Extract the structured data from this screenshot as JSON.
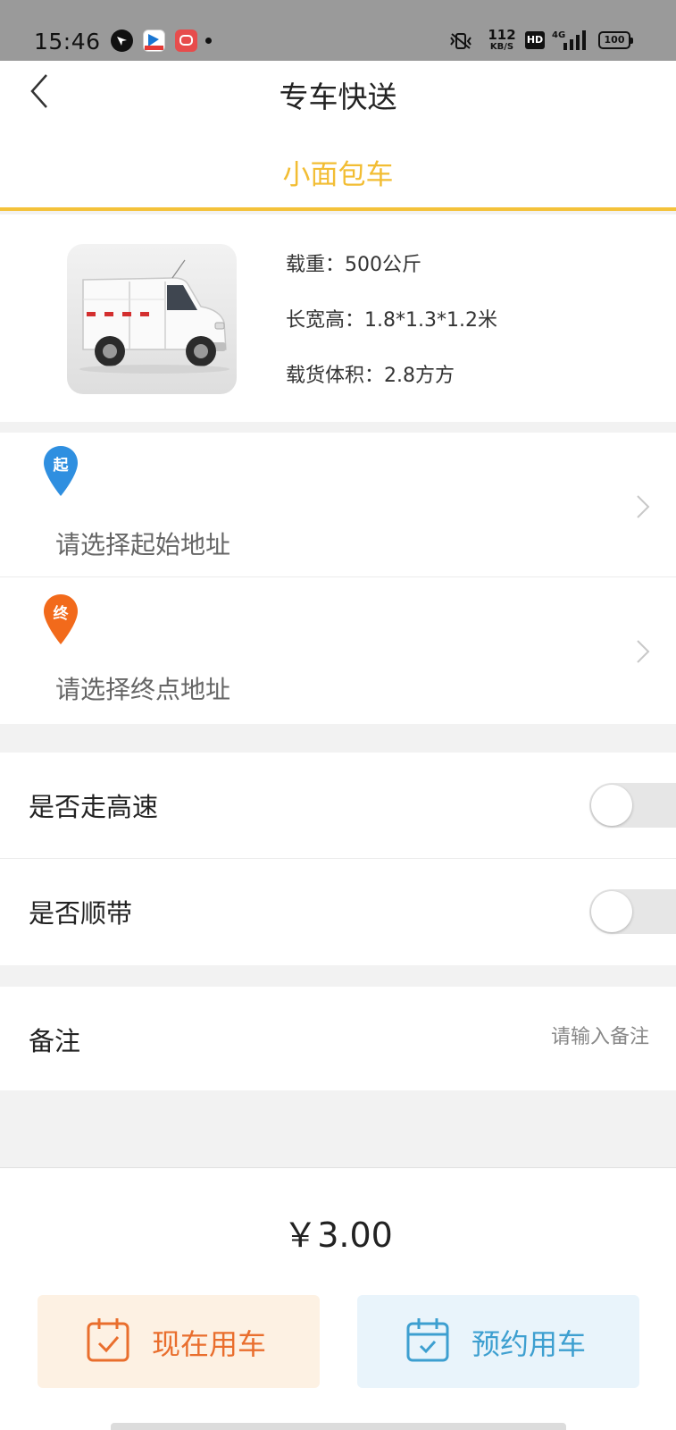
{
  "status_bar": {
    "time": "15:46",
    "net_speed_value": "112",
    "net_speed_unit": "KB/S",
    "hd_label": "HD",
    "network_type": "4G",
    "battery": "100"
  },
  "header": {
    "title": "专车快送",
    "back_icon": "chevron-left-icon"
  },
  "vehicle_tab": {
    "label": "小面包车",
    "accent_color": "#f2bd33"
  },
  "vehicle": {
    "image_icon": "minivan-image",
    "load": "载重：500公斤",
    "dimensions": "长宽高：1.8*1.3*1.2米",
    "volume": "载货体积：2.8方方"
  },
  "address": {
    "start_pin_text": "起",
    "start_placeholder": "请选择起始地址",
    "start_color": "#2f8fe0",
    "end_pin_text": "终",
    "end_placeholder": "请选择终点地址",
    "end_color": "#f26a1b"
  },
  "options": {
    "highway_label": "是否走高速",
    "highway_on": false,
    "carpool_label": "是否顺带",
    "carpool_on": false
  },
  "remark": {
    "label": "备注",
    "placeholder": "请输入备注"
  },
  "price": "￥3.00",
  "actions": {
    "now_label": "现在用车",
    "now_color": "#e96e2d",
    "book_label": "预约用车",
    "book_color": "#3d9fd0"
  }
}
